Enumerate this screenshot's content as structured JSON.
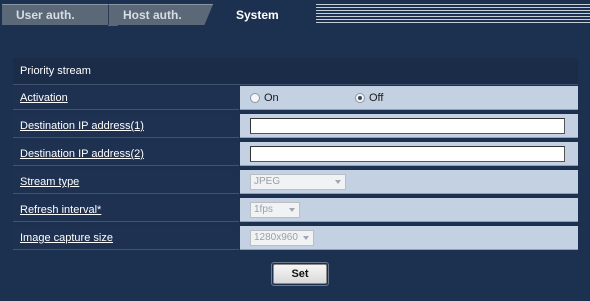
{
  "tabs": [
    {
      "label": "User auth.",
      "active": false
    },
    {
      "label": "Host auth.",
      "active": false
    },
    {
      "label": "System",
      "active": true
    }
  ],
  "section": {
    "title": "Priority stream"
  },
  "rows": {
    "activation": {
      "label": "Activation",
      "options": [
        "On",
        "Off"
      ],
      "selected": "Off"
    },
    "dest1": {
      "label": "Destination IP address(1)",
      "value": ""
    },
    "dest2": {
      "label": "Destination IP address(2)",
      "value": ""
    },
    "stream_type": {
      "label": "Stream type",
      "value": "JPEG"
    },
    "refresh": {
      "label": "Refresh interval*",
      "value": "1fps"
    },
    "capture_size": {
      "label": "Image capture size",
      "value": "1280x960"
    }
  },
  "set_button": {
    "label": "Set"
  },
  "colors": {
    "background": "#1c304f",
    "value_cell": "#c4d1e3"
  }
}
